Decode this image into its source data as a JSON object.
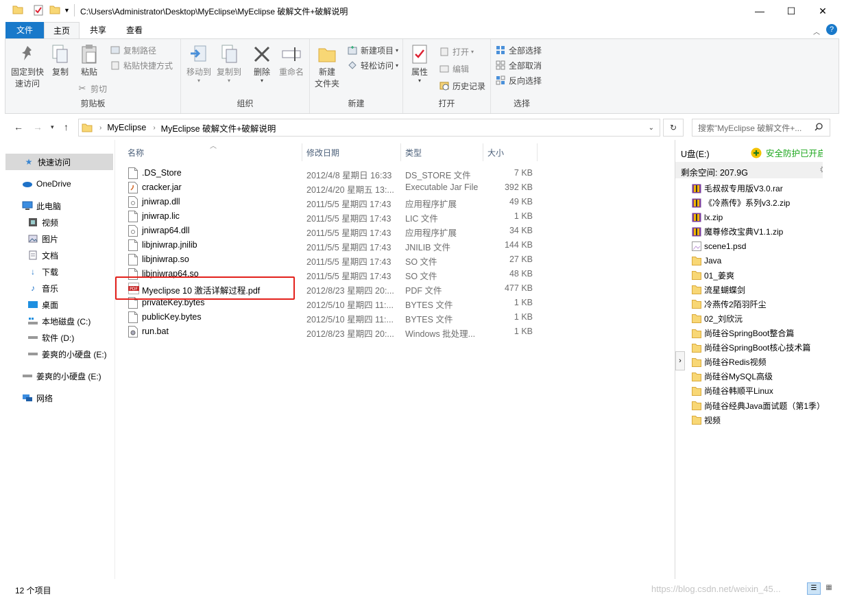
{
  "titlebar": {
    "path": "C:\\Users\\Administrator\\Desktop\\MyEclipse\\MyEclipse 破解文件+破解说明"
  },
  "ribbon_tabs": [
    "文件",
    "主页",
    "共享",
    "查看"
  ],
  "ribbon": {
    "clipboard": {
      "pin": "固定到快\n速访问",
      "copy": "复制",
      "paste": "粘贴",
      "copy_path": "复制路径",
      "paste_shortcut": "粘贴快捷方式",
      "cut": "剪切",
      "label": "剪贴板"
    },
    "organize": {
      "move_to": "移动到",
      "copy_to": "复制到",
      "delete": "删除",
      "rename": "重命名",
      "label": "组织"
    },
    "new": {
      "new_folder": "新建\n文件夹",
      "new_item": "新建项目",
      "easy_access": "轻松访问",
      "label": "新建"
    },
    "open": {
      "properties": "属性",
      "open": "打开",
      "edit": "编辑",
      "history": "历史记录",
      "label": "打开"
    },
    "select": {
      "select_all": "全部选择",
      "select_none": "全部取消",
      "invert": "反向选择",
      "label": "选择"
    }
  },
  "address": {
    "crumbs": [
      "MyEclipse",
      "MyEclipse 破解文件+破解说明"
    ],
    "search_placeholder": "搜索\"MyEclipse 破解文件+..."
  },
  "nav": [
    "快速访问",
    "OneDrive",
    "此电脑",
    "视频",
    "图片",
    "文档",
    "下载",
    "音乐",
    "桌面",
    "本地磁盘 (C:)",
    "软件 (D:)",
    "姜爽的小硬盘 (E:)",
    "姜爽的小硬盘 (E:)",
    "网络"
  ],
  "columns": {
    "name": "名称",
    "date": "修改日期",
    "type": "类型",
    "size": "大小"
  },
  "files": [
    {
      "name": ".DS_Store",
      "date": "2012/4/8 星期日 16:33",
      "type": "DS_STORE 文件",
      "size": "7 KB",
      "icon": "file-icon"
    },
    {
      "name": "cracker.jar",
      "date": "2012/4/20 星期五 13:...",
      "type": "Executable Jar File",
      "size": "392 KB",
      "icon": "jar-icon"
    },
    {
      "name": "jniwrap.dll",
      "date": "2011/5/5 星期四 17:43",
      "type": "应用程序扩展",
      "size": "49 KB",
      "icon": "dll-icon"
    },
    {
      "name": "jniwrap.lic",
      "date": "2011/5/5 星期四 17:43",
      "type": "LIC 文件",
      "size": "1 KB",
      "icon": "file-icon"
    },
    {
      "name": "jniwrap64.dll",
      "date": "2011/5/5 星期四 17:43",
      "type": "应用程序扩展",
      "size": "34 KB",
      "icon": "dll-icon"
    },
    {
      "name": "libjniwrap.jnilib",
      "date": "2011/5/5 星期四 17:43",
      "type": "JNILIB 文件",
      "size": "144 KB",
      "icon": "file-icon"
    },
    {
      "name": "libjniwrap.so",
      "date": "2011/5/5 星期四 17:43",
      "type": "SO 文件",
      "size": "27 KB",
      "icon": "file-icon"
    },
    {
      "name": "libjniwrap64.so",
      "date": "2011/5/5 星期四 17:43",
      "type": "SO 文件",
      "size": "48 KB",
      "icon": "file-icon"
    },
    {
      "name": "Myeclipse 10 激活详解过程.pdf",
      "date": "2012/8/23 星期四 20:...",
      "type": "PDF 文件",
      "size": "477 KB",
      "icon": "pdf-icon"
    },
    {
      "name": "privateKey.bytes",
      "date": "2012/5/10 星期四 11:...",
      "type": "BYTES 文件",
      "size": "1 KB",
      "icon": "file-icon"
    },
    {
      "name": "publicKey.bytes",
      "date": "2012/5/10 星期四 11:...",
      "type": "BYTES 文件",
      "size": "1 KB",
      "icon": "file-icon"
    },
    {
      "name": "run.bat",
      "date": "2012/8/23 星期四 20:...",
      "type": "Windows 批处理...",
      "size": "1 KB",
      "icon": "bat-icon"
    }
  ],
  "usb": {
    "title": "U盘(E:)",
    "safe": "安全防护已开启",
    "free": "剩余空间: 207.9G",
    "items": [
      {
        "name": "毛叔叔专用版V3.0.rar",
        "icon": "archive-icon"
      },
      {
        "name": "《冷燕传》系列v3.2.zip",
        "icon": "archive-icon"
      },
      {
        "name": "lx.zip",
        "icon": "archive-icon"
      },
      {
        "name": "魔尊修改宝典V1.1.zip",
        "icon": "archive-icon"
      },
      {
        "name": "scene1.psd",
        "icon": "image-icon"
      },
      {
        "name": "Java",
        "icon": "folder-icon"
      },
      {
        "name": "01_姜爽",
        "icon": "folder-icon"
      },
      {
        "name": "流星蝴蝶剑",
        "icon": "folder-icon"
      },
      {
        "name": "冷燕传2陌羽阡尘",
        "icon": "folder-icon"
      },
      {
        "name": "02_刘欣沅",
        "icon": "folder-icon"
      },
      {
        "name": "尚硅谷SpringBoot整合篇",
        "icon": "folder-icon"
      },
      {
        "name": "尚硅谷SpringBoot核心技术篇",
        "icon": "folder-icon"
      },
      {
        "name": "尚硅谷Redis视频",
        "icon": "folder-icon"
      },
      {
        "name": "尚硅谷MySQL高级",
        "icon": "folder-icon"
      },
      {
        "name": "尚硅谷韩顺平Linux",
        "icon": "folder-icon"
      },
      {
        "name": "尚硅谷经典Java面试题（第1季）",
        "icon": "folder-icon"
      },
      {
        "name": "视频",
        "icon": "folder-icon"
      }
    ]
  },
  "status": {
    "count": "12 个项目"
  },
  "watermark": "https://blog.csdn.net/weixin_45..."
}
